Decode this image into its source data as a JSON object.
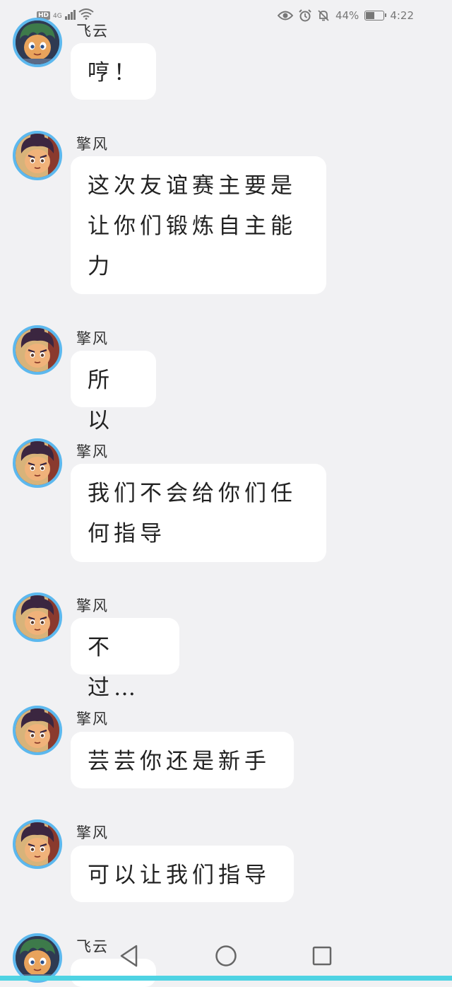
{
  "status_bar": {
    "hd": "HD",
    "network": "4G",
    "battery_percent": "44%",
    "battery_level": 0.44,
    "time": "4:22",
    "icons": [
      "signal-icon",
      "wifi-icon",
      "eye-icon",
      "alarm-icon",
      "mute-bell-icon",
      "battery-icon"
    ]
  },
  "messages": [
    {
      "sender": "飞云",
      "text": "哼！",
      "avatar": "green-hair"
    },
    {
      "sender": "擎风",
      "text": "这次友谊赛主要是让你们锻炼自主能力",
      "avatar": "dark-hair"
    },
    {
      "sender": "擎风",
      "text": "所以",
      "avatar": "dark-hair"
    },
    {
      "sender": "擎风",
      "text": "我们不会给你们任何指导",
      "avatar": "dark-hair"
    },
    {
      "sender": "擎风",
      "text": "不过…",
      "avatar": "dark-hair"
    },
    {
      "sender": "擎风",
      "text": "芸芸你还是新手",
      "avatar": "dark-hair"
    },
    {
      "sender": "擎风",
      "text": "可以让我们指导",
      "avatar": "dark-hair"
    },
    {
      "sender": "飞云",
      "text": "",
      "avatar": "green-hair"
    }
  ],
  "nav": {
    "icons": [
      "back-triangle-icon",
      "home-circle-icon",
      "recents-square-icon"
    ]
  },
  "colors": {
    "background": "#f1f1f3",
    "avatar_ring": "#5cb8ee",
    "bottom_strip": "#4fd3e3"
  }
}
